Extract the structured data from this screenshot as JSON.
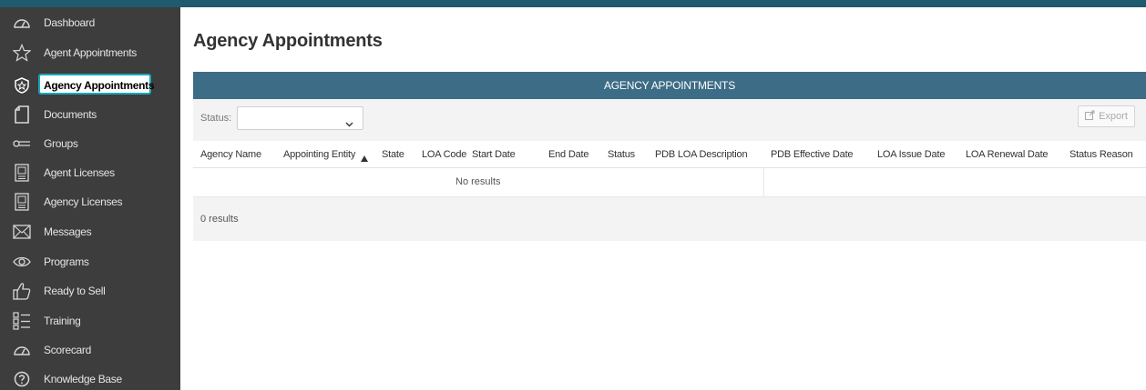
{
  "sidebar": {
    "items": [
      {
        "label": "Dashboard",
        "icon": "gauge-icon",
        "active": false
      },
      {
        "label": "Agent Appointments",
        "icon": "star-icon",
        "active": false
      },
      {
        "label": "Agency Appointments",
        "icon": "shield-star-icon",
        "active": true
      },
      {
        "label": "Documents",
        "icon": "document-icon",
        "active": false
      },
      {
        "label": "Groups",
        "icon": "groups-icon",
        "active": false
      },
      {
        "label": "Agent Licenses",
        "icon": "license-icon",
        "active": false
      },
      {
        "label": "Agency Licenses",
        "icon": "license-icon",
        "active": false
      },
      {
        "label": "Messages",
        "icon": "envelope-icon",
        "active": false
      },
      {
        "label": "Programs",
        "icon": "eye-icon",
        "active": false
      },
      {
        "label": "Ready to Sell",
        "icon": "thumbs-up-icon",
        "active": false
      },
      {
        "label": "Training",
        "icon": "checklist-icon",
        "active": false
      },
      {
        "label": "Scorecard",
        "icon": "gauge-icon",
        "active": false
      },
      {
        "label": "Knowledge Base",
        "icon": "question-circle-icon",
        "active": false
      }
    ]
  },
  "main": {
    "title": "Agency Appointments",
    "panel_title": "AGENCY APPOINTMENTS",
    "filter": {
      "status_label": "Status:",
      "status_value": ""
    },
    "export_label": "Export",
    "columns": [
      "Agency Name",
      "Appointing Entity",
      "State",
      "LOA Code",
      "Start Date",
      "End Date",
      "Status",
      "PDB LOA Description",
      "PDB Effective Date",
      "LOA Issue Date",
      "LOA Renewal Date",
      "Status Reason"
    ],
    "sort": {
      "column": "Appointing Entity",
      "direction": "ascending"
    },
    "empty_text": "No results",
    "results_count": "0 results"
  },
  "colors": {
    "topbar": "#1f5a6e",
    "sidebar_bg": "#3d3d3d",
    "panel_header": "#3d6c86",
    "active_outline": "#18a9b8"
  }
}
